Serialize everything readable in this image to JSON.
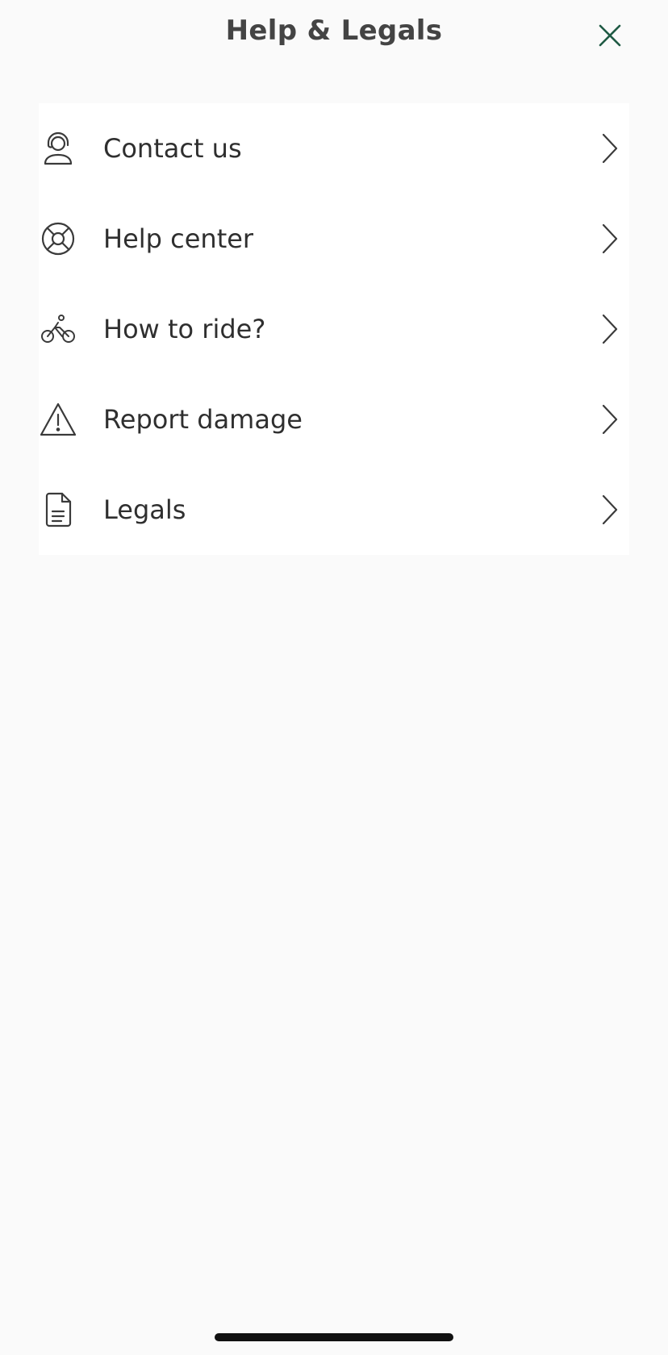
{
  "header": {
    "title": "Help & Legals",
    "close_icon": "close-icon",
    "accent_color": "#1f5a44"
  },
  "menu": {
    "items": [
      {
        "label": "Contact us",
        "icon": "headset-person-icon"
      },
      {
        "label": "Help center",
        "icon": "lifebuoy-icon"
      },
      {
        "label": "How to ride?",
        "icon": "bike-rider-icon"
      },
      {
        "label": "Report damage",
        "icon": "warning-triangle-icon"
      },
      {
        "label": "Legals",
        "icon": "document-icon"
      }
    ],
    "chevron_icon": "chevron-right-icon"
  },
  "colors": {
    "background": "#fafafa",
    "card": "#ffffff",
    "text": "#2f2f2f",
    "icon_stroke": "#3a3a3a"
  }
}
